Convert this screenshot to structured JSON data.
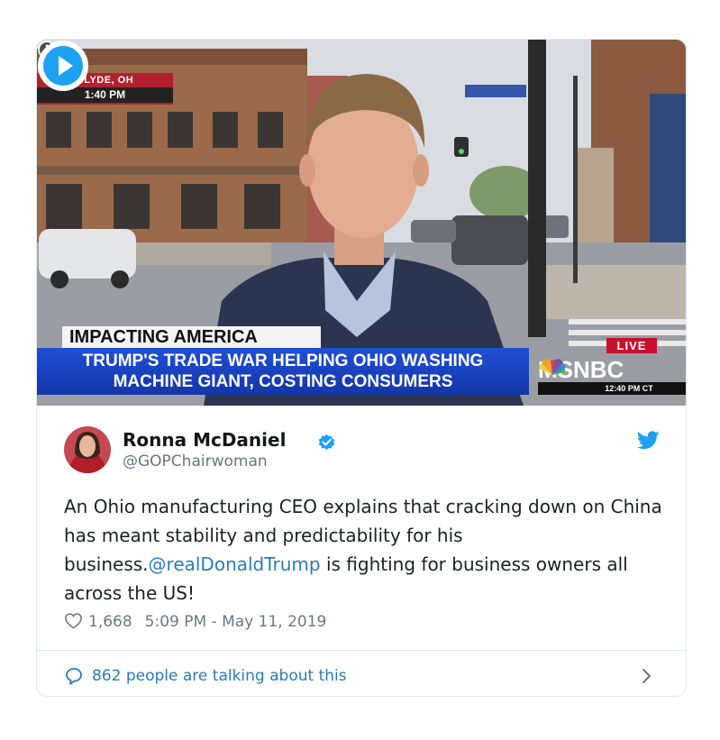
{
  "media": {
    "location": "CLYDE, OH",
    "local_time": "1:40 PM",
    "banner_label": "IMPACTING AMERICA",
    "headline_line1": "TRUMP'S TRADE WAR HELPING OHIO WASHING",
    "headline_line2": "MACHINE GIANT, COSTING CONSUMERS",
    "live_label": "LIVE",
    "network": "MSNBC",
    "ticker_time": "12:40 PM CT",
    "play_icon": "play-icon",
    "info_icon": "info-icon"
  },
  "tweet": {
    "author_name": "Ronna McDaniel",
    "author_handle": "@GOPChairwoman",
    "text_before": "An Ohio manufacturing CEO explains that cracking down on China has meant stability and predictability for his business.",
    "mention": "@realDonaldTrump",
    "text_after": " is fighting for business owners all across the US!",
    "likes": "1,668",
    "timestamp": "5:09 PM - May 11, 2019",
    "talking": "862 people are talking about this"
  },
  "colors": {
    "link": "#2b7bb9",
    "twitter_blue": "#1da1f2",
    "meta_gray": "#697882",
    "msnbc_blue": "#1436a8",
    "live_red": "#c8102e"
  }
}
